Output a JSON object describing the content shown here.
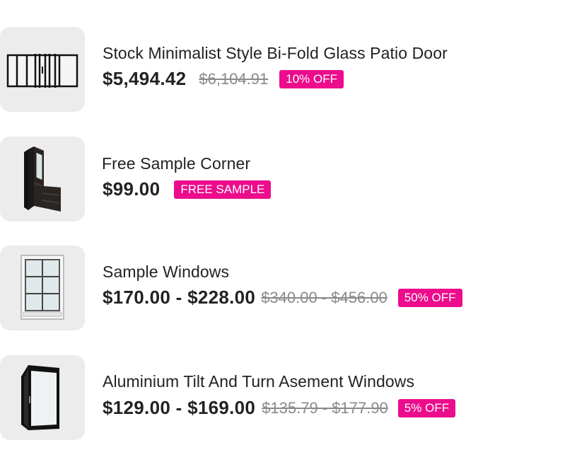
{
  "products": [
    {
      "title": "Stock Minimalist Style Bi-Fold Glass Patio Door",
      "price": "$5,494.42",
      "old_price": "$6,104.91",
      "badge": "10% OFF",
      "image": "bifold-door-icon"
    },
    {
      "title": "Free Sample Corner",
      "price": "$99.00",
      "badge": "FREE SAMPLE",
      "image": "window-corner-sample-icon"
    },
    {
      "title": "Sample Windows",
      "price": "$170.00 - $228.00",
      "old_price": "$340.00 - $456.00",
      "badge": "50% OFF",
      "image": "grid-window-icon"
    },
    {
      "title": "Aluminium Tilt And Turn  Asement Windows",
      "price": "$129.00 - $169.00",
      "old_price": "$135.79 - $177.90",
      "badge": "5% OFF",
      "image": "tilt-turn-window-icon"
    }
  ],
  "colors": {
    "badge": "#ec0c8c",
    "thumb_bg": "#ececec",
    "old_price": "#8a8a8a"
  }
}
